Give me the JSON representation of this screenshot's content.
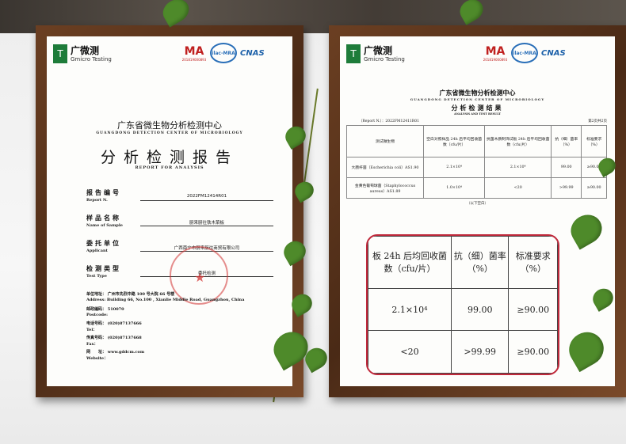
{
  "left_certificate": {
    "brand_cn": "广微测",
    "brand_en": "Gmicro Testing",
    "brand_mark": "T",
    "ma_logo": "MA",
    "ma_code": "201819000893",
    "ilac_logo": "ilac-MRA",
    "cnas_logo": "CNAS",
    "org_title": "广东省微生物分析检测中心",
    "org_subtitle": "GUANGDONG DETECTION CENTER OF MICROBIOLOGY",
    "doc_title": "分析检测报告",
    "doc_title_en": "REPORT FOR ANALYSIS",
    "fields": [
      {
        "label": "报告编号",
        "label_en": "Report N.",
        "value": "2022FM12414R01"
      },
      {
        "label": "样品名称",
        "label_en": "Name of Sample",
        "value": "厨来厨往铁木菜板"
      },
      {
        "label": "委托单位",
        "label_en": "Applicant",
        "value": "广西南宁市厨来厨往商贸有限公司"
      },
      {
        "label": "检测类型",
        "label_en": "Test Type",
        "value": "委托检测"
      }
    ],
    "address_block": [
      {
        "label": "单位地址：",
        "value": "广州市先烈中路 100 号大院 66 号楼"
      },
      {
        "label": "Address:",
        "value": "Building 66, No.100 , Xianlie Middle Road, Guangzhou, China"
      },
      {
        "label": "邮政编码：",
        "value": "510070"
      },
      {
        "label": "Postcode:",
        "value": ""
      },
      {
        "label": "电话号码：",
        "value": "(020)87137666"
      },
      {
        "label": "Tel：",
        "value": ""
      },
      {
        "label": "传真号码：",
        "value": "(020)87137668"
      },
      {
        "label": "Fax：",
        "value": ""
      },
      {
        "label": "网　　址：",
        "value": "www.gddcm.com"
      },
      {
        "label": "Website：",
        "value": ""
      }
    ]
  },
  "right_certificate": {
    "brand_cn": "广微测",
    "brand_en": "Gmicro Testing",
    "brand_mark": "T",
    "ma_logo": "MA",
    "ma_code": "201819000893",
    "ilac_logo": "ilac-MRA",
    "cnas_logo": "CNAS",
    "org_title": "广东省微生物分析检测中心",
    "org_subtitle": "GUANGDONG DETECTION CENTER OF MICROBIOLOGY",
    "section_title": "分析检测结果",
    "section_title_en": "ANALYSIS AND TEST RESULT",
    "report_no": "（Report N.）：2022FM12411R01",
    "page_no": "第2页共2页",
    "table_header": [
      "测试微生物",
      "空白对照样品 24h 后平均回收菌数（cfu/片）",
      "抗菌木质制饰试板 24h 后平均回收菌数（cfu/片）",
      "抗（细）菌率（%）",
      "标准要求（%）"
    ],
    "table_rows": [
      [
        "大肠杆菌（Escherichia coli）AS1.90",
        "2.1×10⁴",
        "2.1×10⁴",
        "99.00",
        "≥90.00"
      ],
      [
        "金黄色葡萄球菌（Staphylococcus aureus）AS1.89",
        "1.0×10⁴",
        "<20",
        ">99.99",
        "≥90.00"
      ]
    ],
    "footer_note": "（以下空白）"
  },
  "zoom_callout": {
    "header": [
      "板 24h 后均回收菌数（cfu/片）",
      "抗（细）菌率（%）",
      "标准要求（%）"
    ],
    "rows": [
      [
        "2.1×10⁴",
        "99.00",
        "≥90.00"
      ],
      [
        "<20",
        ">99.99",
        "≥90.00"
      ]
    ]
  },
  "colors": {
    "frame": "#5a3420",
    "stamp": "#d23232",
    "callout": "#c0283a",
    "brand": "#1e7c3a"
  }
}
